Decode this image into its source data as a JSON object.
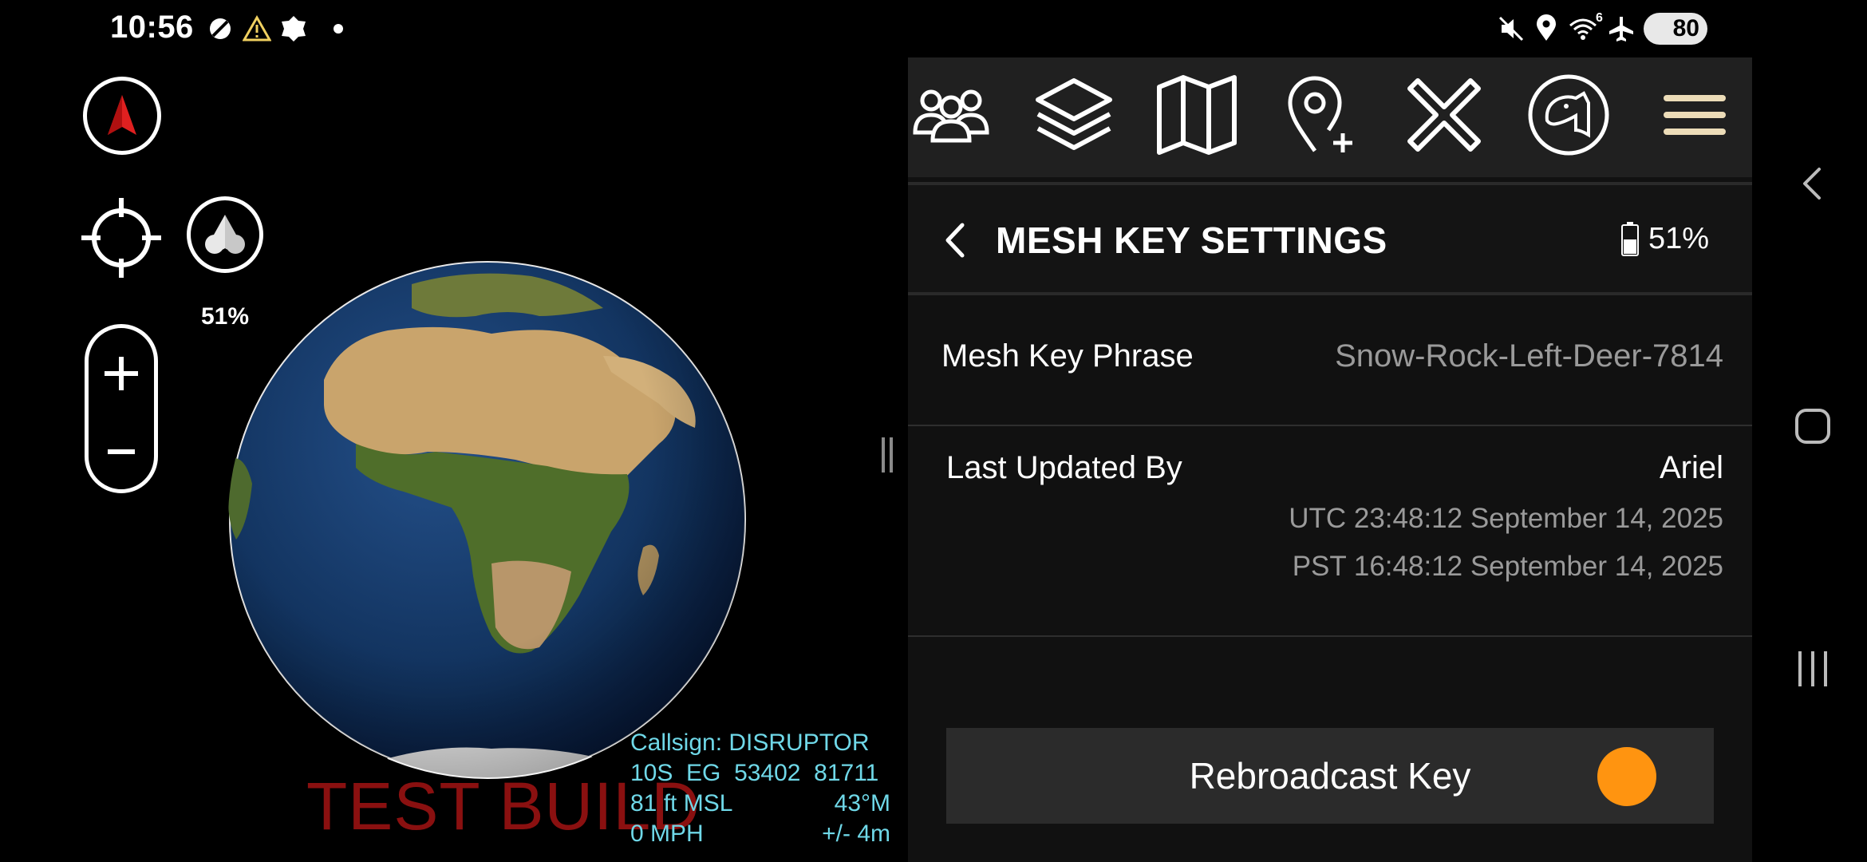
{
  "status_bar": {
    "time": "10:56",
    "left_icons": [
      "no-disturb-icon",
      "warning-icon",
      "shield-badge-icon",
      "dot-icon"
    ],
    "right_icons": [
      "mute-icon",
      "location-icon",
      "wifi-icon",
      "airplane-icon"
    ],
    "wifi_badge": "6",
    "battery_level": "80"
  },
  "map": {
    "mesh_battery": "51%",
    "watermark": "TEST BUILD",
    "hud": {
      "callsign": "Callsign: DISRUPTOR",
      "grid": "10S  EG  53402  81711",
      "altitude": "81 ft MSL",
      "heading": "43°M",
      "speed": "0 MPH",
      "accuracy": "+/- 4m"
    }
  },
  "toolbar": {
    "items": [
      "contacts-icon",
      "layers-icon",
      "map-icon",
      "add-waypoint-icon",
      "close-icon",
      "dog-logo-icon",
      "hamburger-menu-icon"
    ]
  },
  "panel": {
    "title": "MESH KEY SETTINGS",
    "battery": "51%",
    "mesh_key_label": "Mesh Key Phrase",
    "mesh_key_value": "Snow-Rock-Left-Deer-7814",
    "updated_label": "Last Updated By",
    "updated_by": "Ariel",
    "utc_time": "UTC 23:48:12 September 14, 2025",
    "pst_time": "PST 16:48:12 September 14, 2025",
    "rebroadcast_label": "Rebroadcast Key",
    "rebroadcast_on": true
  },
  "colors": {
    "accent": "#ff9410",
    "hud_text": "#6fd8e8",
    "watermark": "#8a1010"
  }
}
